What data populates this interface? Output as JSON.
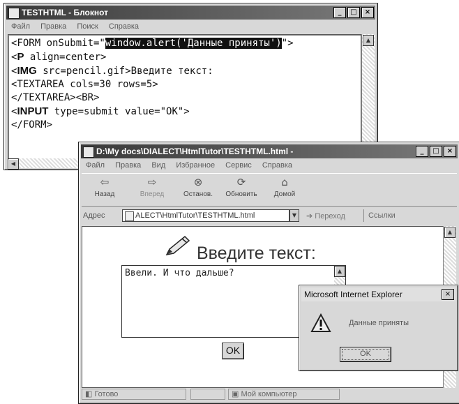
{
  "notepad": {
    "title": "TESTHTML - Блокнот",
    "menu": [
      "Файл",
      "Правка",
      "Поиск",
      "Справка"
    ],
    "code": {
      "line1_pre": "<FORM onSubmit=\"",
      "line1_sel": "window.alert('Данные приняты')",
      "line1_post": "\">",
      "line2_tag": "P",
      "line2_rest": " align=center>",
      "line3_tag": "IMG",
      "line3_rest": " src=pencil.gif>Введите текст:",
      "line4": "<TEXTAREA cols=30 rows=5>",
      "line5": "</TEXTAREA><BR>",
      "line6_tag": "INPUT",
      "line6_rest": " type=submit value=\"OK\">",
      "line7": "</FORM>",
      "lt": "<"
    }
  },
  "ie": {
    "title": "D:\\My docs\\DIALECT\\HtmlTutor\\TESTHTML.html -",
    "menu": [
      "Файл",
      "Правка",
      "Вид",
      "Избранное",
      "Сервис",
      "Справка"
    ],
    "toolbar": {
      "back": "Назад",
      "forward": "Вперед",
      "stop": "Останов.",
      "refresh": "Обновить",
      "home": "Домой"
    },
    "address": {
      "label": "Адрес",
      "value": "ALECT\\HtmlTutor\\TESTHTML.html",
      "go": "Переход",
      "links": "Ссылки"
    },
    "page": {
      "heading": "Введите текст:",
      "textarea_value": "Ввели. И что дальше?",
      "submit_label": "OK"
    },
    "status": {
      "left": "Готово",
      "zone": "Мой компьютер"
    }
  },
  "alert": {
    "title": "Microsoft Internet Explorer",
    "message": "Данные приняты",
    "ok_label": "OK",
    "close_glyph": "×"
  },
  "icons": {
    "window_min": "_",
    "window_max": "□",
    "window_close": "×"
  }
}
